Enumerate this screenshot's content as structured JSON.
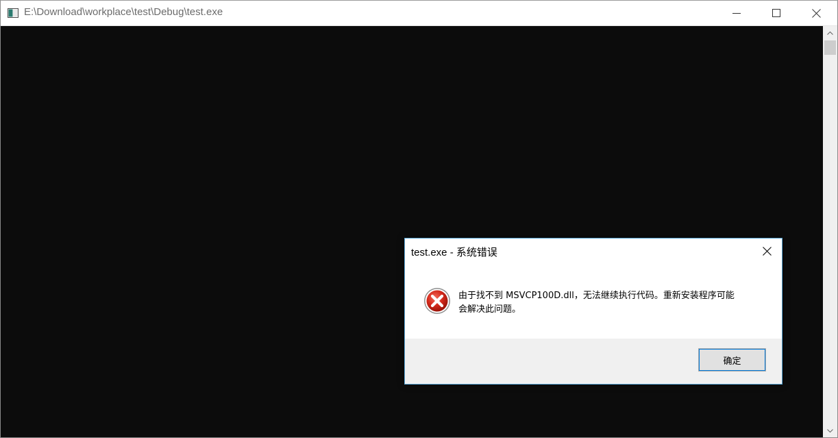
{
  "window": {
    "title": "E:\\Download\\workplace\\test\\Debug\\test.exe",
    "controls": {
      "minimize_icon": "minimize-icon",
      "maximize_icon": "maximize-icon",
      "close_icon": "close-icon"
    },
    "console_background": "#0c0c0c"
  },
  "dialog": {
    "title": "test.exe - 系统错误",
    "icon": "error-icon",
    "message_lines": [
      "由于找不到 MSVCP100D.dll，无法继续执行代码。重新安装程序可能",
      "会解决此问题。"
    ],
    "ok_label": "确定",
    "accent_color": "#0078d7",
    "error_color": "#c42b1c"
  }
}
